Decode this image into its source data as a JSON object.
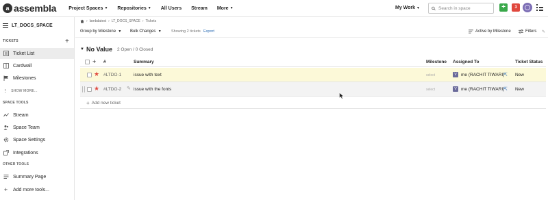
{
  "app": {
    "logo_letter": "a",
    "logo_text": "assembla"
  },
  "topnav": {
    "items": [
      {
        "label": "Project Spaces",
        "dropdown": true
      },
      {
        "label": "Repositories",
        "dropdown": true
      },
      {
        "label": "All Users",
        "dropdown": false
      },
      {
        "label": "Stream",
        "dropdown": false
      },
      {
        "label": "More",
        "dropdown": true
      }
    ],
    "my_work": "My Work",
    "search_placeholder": "Search in space",
    "add_label": "+",
    "notifications_count": "3"
  },
  "sidebar": {
    "space_name": "LT_DOCS_SPACE",
    "tickets_heading": "TICKETS",
    "add_label": "+",
    "ticket_items": [
      {
        "label": "Ticket List",
        "icon": "list-icon",
        "active": true
      },
      {
        "label": "Cardwall",
        "icon": "cardwall-icon",
        "active": false
      },
      {
        "label": "Milestones",
        "icon": "flag-icon",
        "active": false
      }
    ],
    "show_more": "SHOW MORE...",
    "space_tools_heading": "SPACE TOOLS",
    "space_tools": [
      {
        "label": "Stream",
        "icon": "stream-icon"
      },
      {
        "label": "Space Team",
        "icon": "team-icon"
      },
      {
        "label": "Space Settings",
        "icon": "gear-icon"
      },
      {
        "label": "Integrations",
        "icon": "integrations-icon"
      }
    ],
    "other_tools_heading": "OTHER TOOLS",
    "other_tools": [
      {
        "label": "Summary Page",
        "icon": "summary-icon"
      },
      {
        "label": "Add more tools...",
        "icon": "plus-icon"
      }
    ]
  },
  "breadcrumb": [
    "lambdatest",
    "LT_DOCS_SPACE",
    "Tickets"
  ],
  "toolbar": {
    "group_by": "Group by Milestone",
    "bulk_changes": "Bulk Changes",
    "showing": "Showing 2 tickets",
    "export": "Export",
    "active_by": "Active by Milestone",
    "filters": "Filters"
  },
  "group": {
    "title": "No Value",
    "count": "2 Open / 0 Closed"
  },
  "table": {
    "add_col": "+",
    "headers": {
      "id": "#",
      "summary": "Summary",
      "milestone": "Milestone",
      "assigned": "Assigned To",
      "status": "Ticket Status"
    },
    "rows": [
      {
        "id": "#LTDO-1",
        "summary": "issue with text",
        "milestone": "select",
        "assignee_initial": "V",
        "assignee": "me (RACHIT TIWARI)",
        "status": "New"
      },
      {
        "id": "#LTDO-2",
        "summary": "issue with the fonts",
        "milestone": "select",
        "assignee_initial": "V",
        "assignee": "me (RACHIT TIWARI)",
        "status": "New"
      }
    ],
    "add_new": "Add new ticket"
  }
}
